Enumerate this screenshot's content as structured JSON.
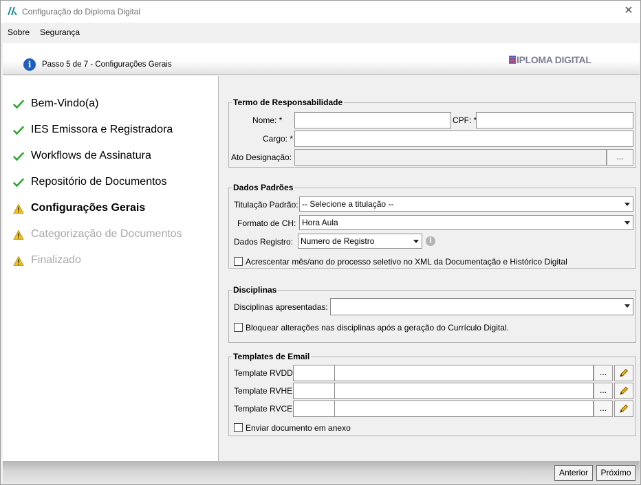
{
  "window": {
    "title": "Configuração do Diploma Digital"
  },
  "menu": [
    {
      "label": "Sobre"
    },
    {
      "label": "Segurança"
    }
  ],
  "banner": {
    "step_text": "Passo 5 de 7 - Configurações Gerais",
    "brand": "IPLOMA DIGITAL"
  },
  "steps": [
    {
      "label": "Bem-Vindo(a)",
      "status": "done"
    },
    {
      "label": "IES Emissora e Registradora",
      "status": "done"
    },
    {
      "label": "Workflows de Assinatura",
      "status": "done"
    },
    {
      "label": "Repositório de Documentos",
      "status": "done"
    },
    {
      "label": "Configurações Gerais",
      "status": "current"
    },
    {
      "label": "Categorização de Documentos",
      "status": "pending"
    },
    {
      "label": "Finalizado",
      "status": "pending"
    }
  ],
  "termo": {
    "title": "Termo de Responsabilidade",
    "nome_label": "Nome: *",
    "nome_value": "",
    "cpf_label": "CPF: *",
    "cpf_value": "",
    "cargo_label": "Cargo: *",
    "cargo_value": "",
    "ato_label": "Ato Designação:",
    "ato_value": "",
    "browse_label": "..."
  },
  "dados": {
    "title": "Dados Padrões",
    "titulacao_label": "Titulação Padrão:",
    "titulacao_value": "-- Selecione a titulação --",
    "formato_label": "Formato de CH:",
    "formato_value": "Hora Aula",
    "registro_label": "Dados Registro:",
    "registro_value": "Numero de Registro",
    "acrescentar_label": "Acrescentar mês/ano do processo seletivo no XML da Documentação e Histórico Digital",
    "acrescentar_checked": false
  },
  "disciplinas": {
    "title": "Disciplinas",
    "apresentadas_label": "Disciplinas apresentadas: *",
    "apresentadas_value": "",
    "bloquear_label": "Bloquear alterações nas disciplinas após a geração do Currículo Digital.",
    "bloquear_checked": false
  },
  "templates": {
    "title": "Templates de Email",
    "rows": [
      {
        "label": "Template RVDD:",
        "code": "",
        "name": ""
      },
      {
        "label": "Template RVHE:",
        "code": "",
        "name": ""
      },
      {
        "label": "Template RVCE:",
        "code": "",
        "name": ""
      }
    ],
    "browse_label": "...",
    "anexo_label": "Enviar documento em anexo",
    "anexo_checked": false
  },
  "footer": {
    "anterior_label": "Anterior",
    "proximo_label": "Próximo"
  },
  "colors": {
    "check_green": "#2fa82f",
    "warning_yellow": "#f2c01b",
    "info_blue": "#1f5fbf"
  }
}
